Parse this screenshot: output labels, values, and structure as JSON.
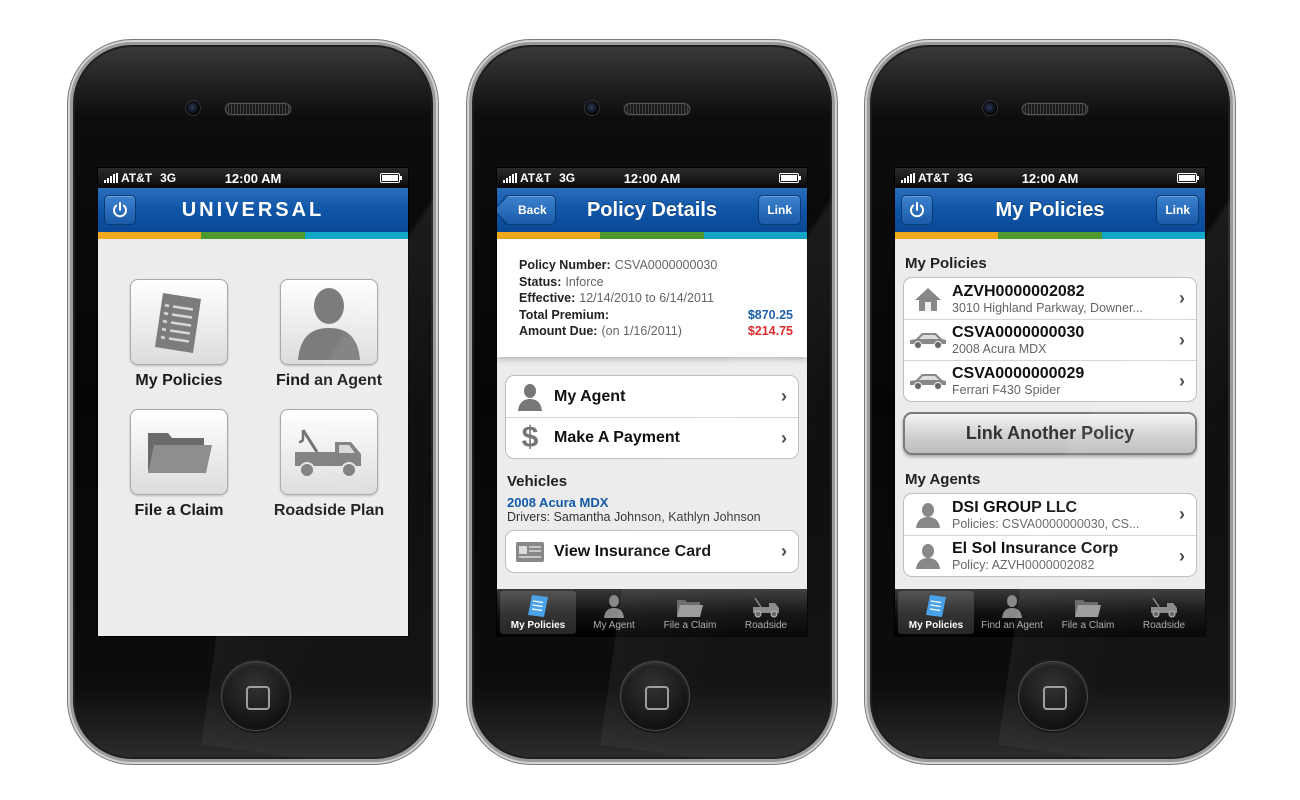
{
  "status_bar": {
    "carrier": "AT&T",
    "network": "3G",
    "time": "12:00 AM"
  },
  "colors": {
    "nav_blue": "#0f55a7",
    "strip": [
      "#f0a81c",
      "#4f9a2e",
      "#12a6c9"
    ],
    "premium_blue": "#1259a8",
    "due_red": "#d81e1e"
  },
  "screen1": {
    "brand": "UNIVERSAL",
    "power_icon": "power-icon",
    "tiles": [
      {
        "label": "My Policies",
        "icon": "document-list-icon"
      },
      {
        "label": "Find an Agent",
        "icon": "person-icon"
      },
      {
        "label": "File a Claim",
        "icon": "folder-icon"
      },
      {
        "label": "Roadside Plan",
        "icon": "tow-truck-icon"
      }
    ]
  },
  "screen2": {
    "back_label": "Back",
    "title": "Policy Details",
    "link_label": "Link",
    "policy": {
      "number_label": "Policy Number:",
      "number": "CSVA0000000030",
      "status_label": "Status:",
      "status": "Inforce",
      "effective_label": "Effective:",
      "effective": "12/14/2010 to 6/14/2011",
      "premium_label": "Total Premium:",
      "premium": "$870.25",
      "due_label": "Amount Due:",
      "due_date": "(on 1/16/2011)",
      "due": "$214.75"
    },
    "actions": [
      {
        "label": "My Agent",
        "icon": "person-icon"
      },
      {
        "label": "Make A Payment",
        "icon": "dollar-icon"
      }
    ],
    "vehicles_heading": "Vehicles",
    "vehicle_name": "2008 Acura MDX",
    "drivers": "Drivers: Samantha Johnson, Kathlyn Johnson",
    "card_label": "View Insurance Card",
    "tabs": [
      "My Policies",
      "My Agent",
      "File a Claim",
      "Roadside"
    ]
  },
  "screen3": {
    "title": "My Policies",
    "link_label": "Link",
    "policies_heading": "My Policies",
    "policies": [
      {
        "number": "AZVH0000002082",
        "detail": "3010 Highland Parkway, Downer...",
        "icon": "house-icon"
      },
      {
        "number": "CSVA0000000030",
        "detail": "2008 Acura MDX",
        "icon": "car-icon"
      },
      {
        "number": "CSVA0000000029",
        "detail": "Ferrari F430 Spider",
        "icon": "car-icon"
      }
    ],
    "link_another": "Link Another Policy",
    "agents_heading": "My Agents",
    "agents": [
      {
        "name": "DSI GROUP LLC",
        "detail": "Policies: CSVA0000000030, CS..."
      },
      {
        "name": "El Sol Insurance Corp",
        "detail": "Policy: AZVH0000002082"
      }
    ],
    "tabs": [
      "My Policies",
      "Find an Agent",
      "File a Claim",
      "Roadside"
    ]
  }
}
